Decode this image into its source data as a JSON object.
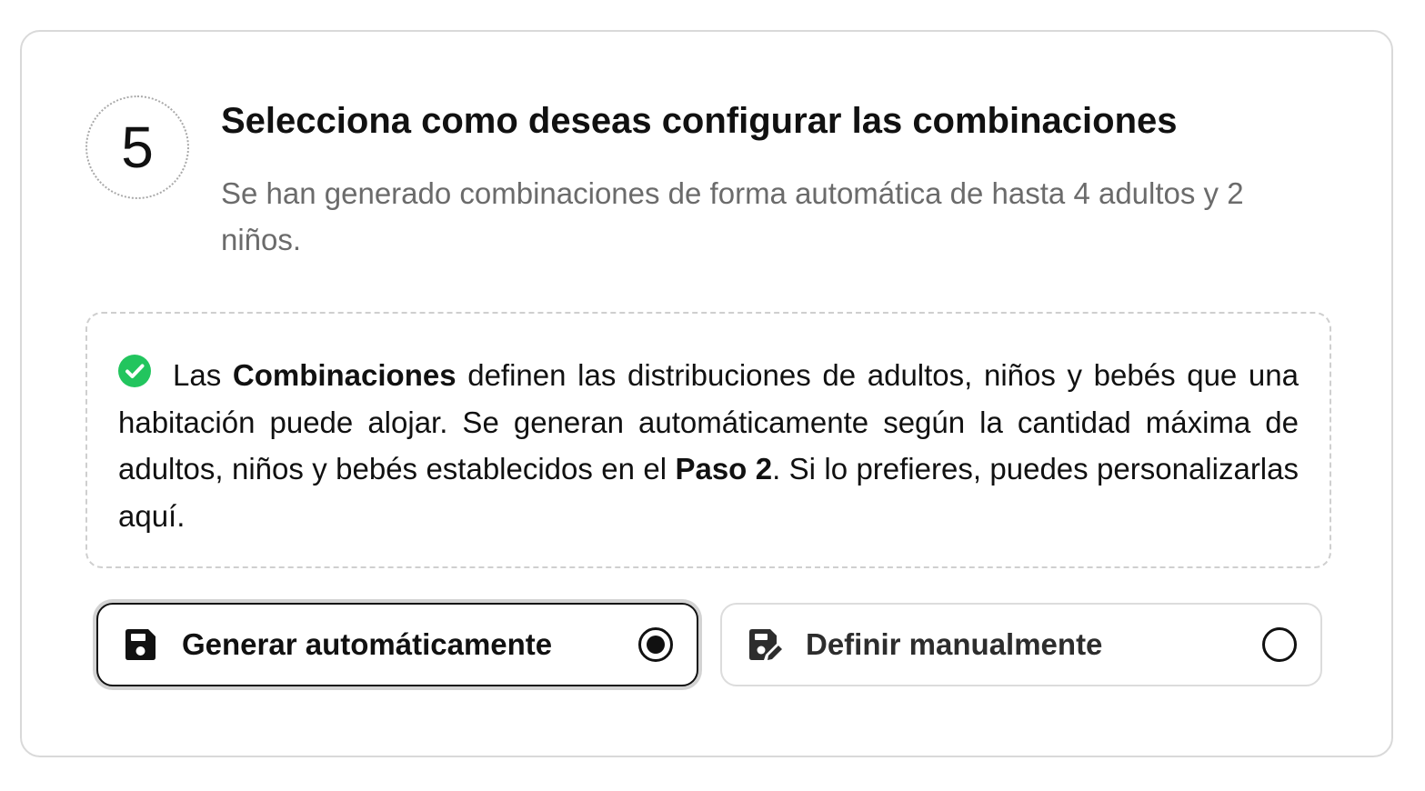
{
  "step": {
    "number": "5",
    "title": "Selecciona como deseas configurar las combinaciones",
    "subtitle": "Se han generado combinaciones de forma automática de hasta 4 adultos y 2 niños."
  },
  "info": {
    "icon": "check-circle-icon",
    "icon_color": "#22c55e",
    "text_part1": "Las ",
    "text_bold1": "Combinaciones",
    "text_part2": " definen las distribuciones de adultos, niños y bebés que una habitación puede alojar. Se generan automáticamente según la cantidad máxima de adultos, niños y bebés establecidos en el ",
    "text_bold2": "Paso 2",
    "text_part3": ". Si lo prefieres, puedes personalizarlas aquí."
  },
  "options": [
    {
      "label": "Generar automáticamente",
      "icon": "save-icon",
      "selected": true
    },
    {
      "label": "Definir manualmente",
      "icon": "edit-save-icon",
      "selected": false
    }
  ]
}
